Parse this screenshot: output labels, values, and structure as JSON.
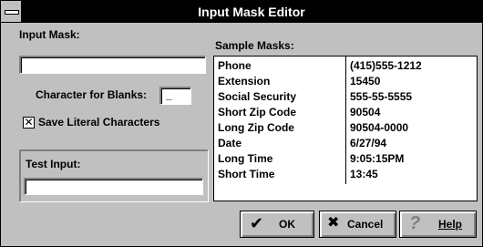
{
  "window": {
    "title": "Input Mask Editor"
  },
  "left": {
    "input_mask_label": "Input Mask:",
    "input_mask_value": "",
    "blanks_label": "Character for Blanks:",
    "blanks_value": "_",
    "save_literal_label": "Save Literal Characters",
    "save_literal_checked": "✕",
    "test_input_label": "Test Input:",
    "test_input_value": ""
  },
  "samples": {
    "label": "Sample Masks:",
    "rows": [
      {
        "name": "Phone",
        "value": "(415)555-1212"
      },
      {
        "name": "Extension",
        "value": "15450"
      },
      {
        "name": "Social Security",
        "value": "555-55-5555"
      },
      {
        "name": "Short Zip Code",
        "value": "90504"
      },
      {
        "name": "Long Zip Code",
        "value": "90504-0000"
      },
      {
        "name": "Date",
        "value": "6/27/94"
      },
      {
        "name": "Long Time",
        "value": "9:05:15PM"
      },
      {
        "name": "Short Time",
        "value": "13:45"
      }
    ]
  },
  "buttons": {
    "ok": {
      "label": "OK",
      "icon": "checkmark-icon",
      "glyph": "✔"
    },
    "cancel": {
      "label": "Cancel",
      "icon": "x-icon",
      "glyph": "✖"
    },
    "help": {
      "label": "Help",
      "icon": "question-icon",
      "glyph": "?"
    }
  }
}
